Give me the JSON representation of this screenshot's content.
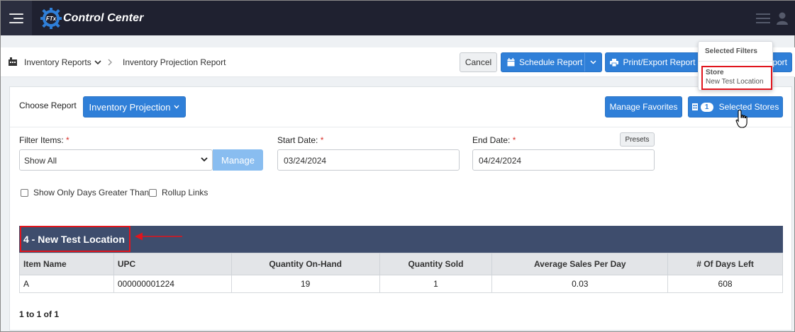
{
  "app": {
    "title": "Control Center",
    "logo_badge": "FTx"
  },
  "breadcrumb": {
    "section": "Inventory Reports",
    "current": "Inventory Projection Report"
  },
  "toolbar": {
    "cancel_label": "Cancel",
    "schedule_label": "Schedule Report",
    "print_label": "Print/Export Report",
    "report_label": "port"
  },
  "report": {
    "choose_label": "Choose Report",
    "selected_report": "Inventory Projection",
    "favorites_label": "Manage Favorites",
    "stores_count": "1",
    "stores_label": "Selected Stores"
  },
  "filters": {
    "filter_items_label": "Filter Items:",
    "filter_items_value": "Show All",
    "manage_label": "Manage",
    "start_label": "Start Date:",
    "start_value": "03/24/2024",
    "end_label": "End Date:",
    "end_value": "04/24/2024",
    "presets_label": "Presets",
    "required_mark": "*",
    "show_days_label": "Show Only Days Greater Than",
    "rollup_label": "Rollup Links"
  },
  "store_header": "4 - New Test Location",
  "table": {
    "columns": [
      "Item Name",
      "UPC",
      "Quantity On-Hand",
      "Quantity Sold",
      "Average Sales Per Day",
      "# Of Days Left"
    ],
    "rows": [
      [
        "A",
        "000000001224",
        "19",
        "1",
        "0.03",
        "608"
      ]
    ]
  },
  "pager": "1 to 1 of 1",
  "popover": {
    "title": "Selected Filters",
    "key": "Store",
    "value": "New Test Location"
  },
  "colors": {
    "primary": "#2f7fd8",
    "navbar": "#1f2130",
    "store_bar": "#3e4d6d",
    "highlight": "#e0151d"
  }
}
